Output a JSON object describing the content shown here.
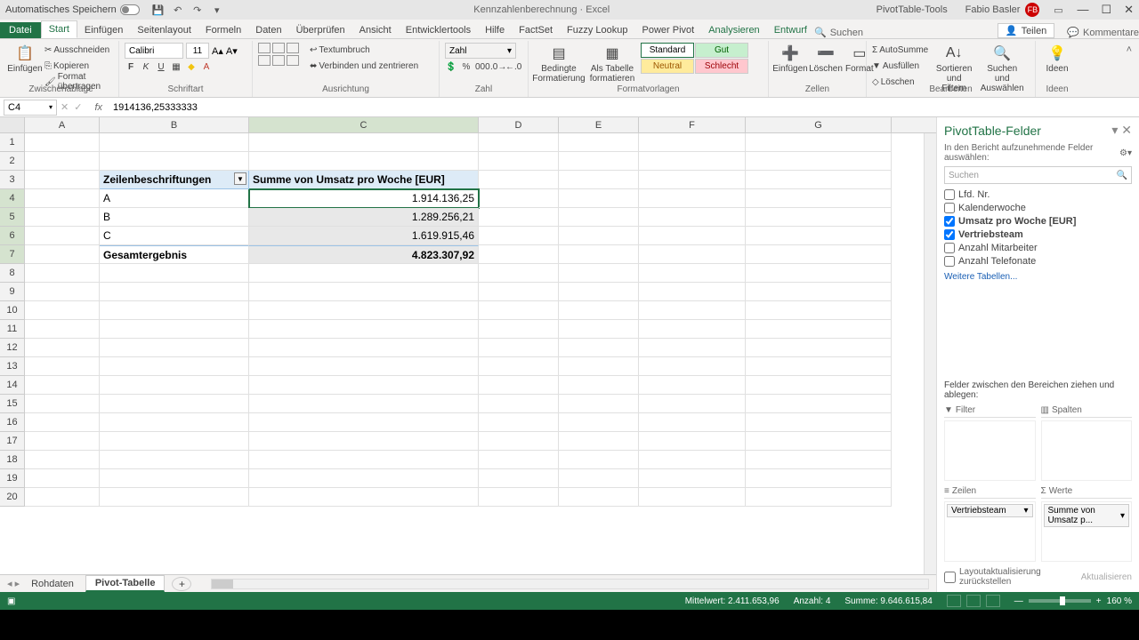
{
  "title": {
    "autosave": "Automatisches Speichern",
    "doc": "Kennzahlenberechnung",
    "app": "Excel",
    "tools": "PivotTable-Tools",
    "user": "Fabio Basler",
    "avatar": "FB"
  },
  "tabs": {
    "file": "Datei",
    "items": [
      "Start",
      "Einfügen",
      "Seitenlayout",
      "Formeln",
      "Daten",
      "Überprüfen",
      "Ansicht",
      "Entwicklertools",
      "Hilfe",
      "FactSet",
      "Fuzzy Lookup",
      "Power Pivot",
      "Analysieren",
      "Entwurf"
    ],
    "active": "Start",
    "search": "Suchen",
    "share": "Teilen",
    "comments": "Kommentare"
  },
  "ribbon": {
    "clipboard": {
      "paste": "Einfügen",
      "cut": "Ausschneiden",
      "copy": "Kopieren",
      "format_painter": "Format übertragen",
      "label": "Zwischenablage"
    },
    "font": {
      "name": "Calibri",
      "size": "11",
      "label": "Schriftart"
    },
    "align": {
      "wrap": "Textumbruch",
      "merge": "Verbinden und zentrieren",
      "label": "Ausrichtung"
    },
    "number": {
      "format": "Zahl",
      "label": "Zahl"
    },
    "styles": {
      "cond": "Bedingte\nFormatierung",
      "table": "Als Tabelle\nformatieren",
      "standard": "Standard",
      "gut": "Gut",
      "neutral": "Neutral",
      "schlecht": "Schlecht",
      "label": "Formatvorlagen"
    },
    "cells": {
      "insert": "Einfügen",
      "delete": "Löschen",
      "format": "Format",
      "label": "Zellen"
    },
    "editing": {
      "sum": "AutoSumme",
      "fill": "Ausfüllen",
      "clear": "Löschen",
      "sort": "Sortieren und\nFiltern",
      "find": "Suchen und\nAuswählen",
      "label": "Bearbeiten"
    },
    "ideas": {
      "btn": "Ideen",
      "label": "Ideen"
    }
  },
  "fbar": {
    "cell": "C4",
    "value": "1914136,25333333"
  },
  "columns": [
    "A",
    "B",
    "C",
    "D",
    "E",
    "F",
    "G"
  ],
  "pivot": {
    "row_label_hdr": "Zeilenbeschriftungen",
    "val_hdr": "Summe von Umsatz pro Woche [EUR]",
    "rows": [
      {
        "label": "A",
        "value": "1.914.136,25"
      },
      {
        "label": "B",
        "value": "1.289.256,21"
      },
      {
        "label": "C",
        "value": "1.619.915,46"
      }
    ],
    "total_label": "Gesamtergebnis",
    "total_value": "4.823.307,92"
  },
  "sheets": {
    "items": [
      "Rohdaten",
      "Pivot-Tabelle"
    ],
    "active": "Pivot-Tabelle"
  },
  "fieldpane": {
    "title": "PivotTable-Felder",
    "sub": "In den Bericht aufzunehmende Felder auswählen:",
    "search": "Suchen",
    "fields": [
      {
        "name": "Lfd. Nr.",
        "checked": false
      },
      {
        "name": "Kalenderwoche",
        "checked": false
      },
      {
        "name": "Umsatz pro Woche [EUR]",
        "checked": true
      },
      {
        "name": "Vertriebsteam",
        "checked": true
      },
      {
        "name": "Anzahl Mitarbeiter",
        "checked": false
      },
      {
        "name": "Anzahl Telefonate",
        "checked": false
      }
    ],
    "more": "Weitere Tabellen...",
    "drag": "Felder zwischen den Bereichen ziehen und ablegen:",
    "areas": {
      "filter": "Filter",
      "columns": "Spalten",
      "rows": "Zeilen",
      "values": "Werte"
    },
    "rows_pill": "Vertriebsteam",
    "values_pill": "Summe von Umsatz p...",
    "defer": "Layoutaktualisierung zurückstellen",
    "update": "Aktualisieren"
  },
  "status": {
    "avg_l": "Mittelwert:",
    "avg": "2.411.653,96",
    "cnt_l": "Anzahl:",
    "cnt": "4",
    "sum_l": "Summe:",
    "sum": "9.646.615,84",
    "zoom": "160 %"
  }
}
